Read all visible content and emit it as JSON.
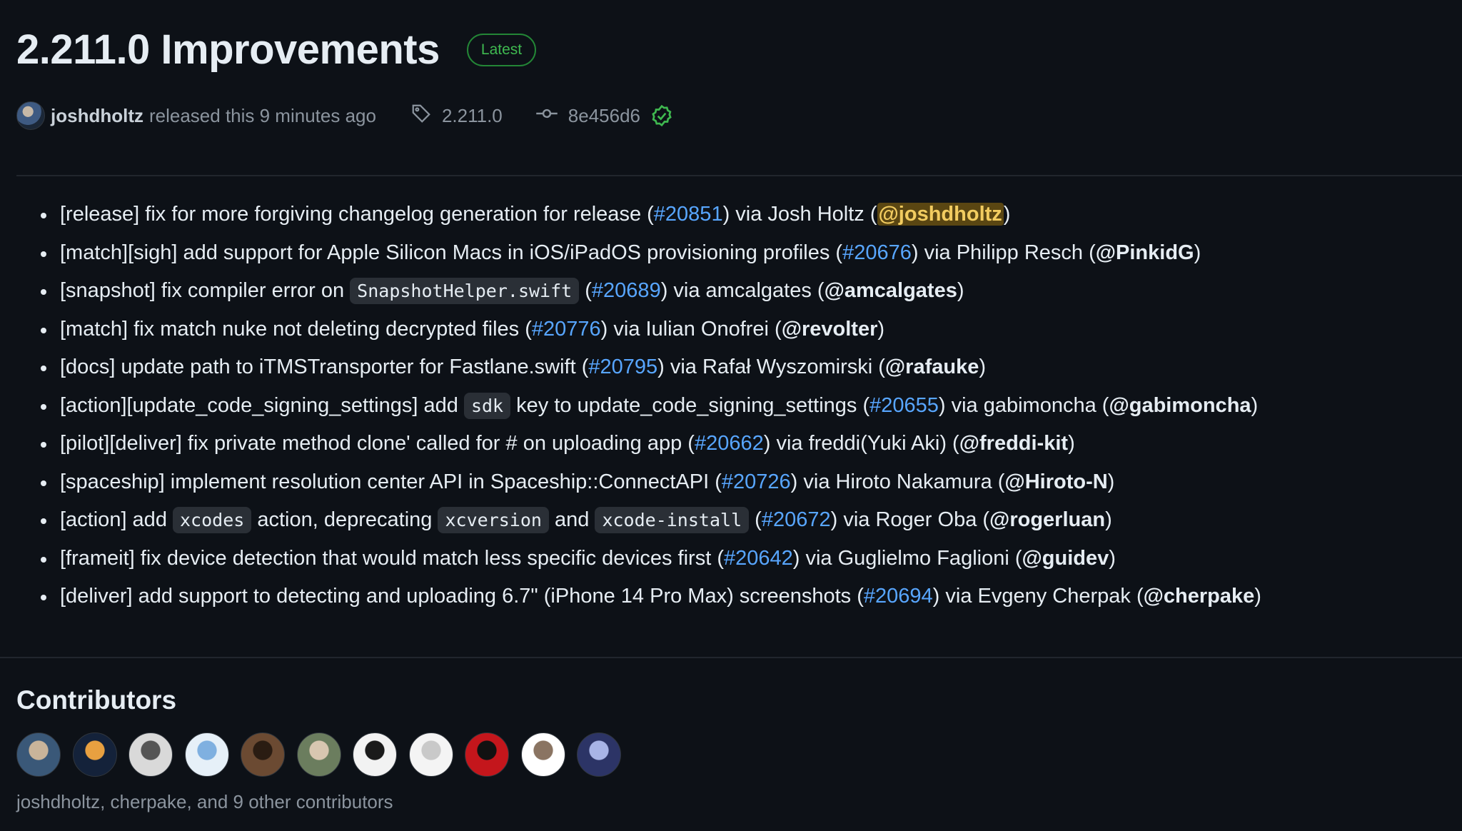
{
  "release": {
    "title": "2.211.0 Improvements",
    "badge": "Latest",
    "author": "joshdholtz",
    "released_text": "released this 9 minutes ago",
    "tag": "2.211.0",
    "commit": "8e456d6"
  },
  "notes": [
    {
      "pre": "[release] fix for more forgiving changelog generation for release (",
      "pr": "#20851",
      "via": ") via Josh Holtz (",
      "handle": "@joshdholtz",
      "end": ")"
    },
    {
      "pre": "[match][sigh] add support for Apple Silicon Macs in iOS/iPadOS provisioning profiles (",
      "pr": "#20676",
      "via": ") via Philipp Resch (",
      "handle": "@PinkidG",
      "end": ")"
    },
    {
      "pre": "[snapshot] fix compiler error on ",
      "code1": "SnapshotHelper.swift",
      "mid": " (",
      "pr": "#20689",
      "via": ") via amcalgates (",
      "handle": "@amcalgates",
      "end": ")"
    },
    {
      "pre": "[match] fix match nuke not deleting decrypted files (",
      "pr": "#20776",
      "via": ") via Iulian Onofrei (",
      "handle": "@revolter",
      "end": ")"
    },
    {
      "pre": "[docs] update path to iTMSTransporter for Fastlane.swift (",
      "pr": "#20795",
      "via": ") via Rafał Wyszomirski (",
      "handle": "@rafauke",
      "end": ")"
    },
    {
      "pre": "[action][update_code_signing_settings] add ",
      "code1": "sdk",
      "mid": " key to update_code_signing_settings (",
      "pr": "#20655",
      "via": ") via gabimoncha (",
      "handle": "@gabimoncha",
      "end": ")"
    },
    {
      "pre": "[pilot][deliver] fix private method clone' called for # on uploading app (",
      "pr": "#20662",
      "via": ") via freddi(Yuki Aki) (",
      "handle": "@freddi-kit",
      "end": ")"
    },
    {
      "pre": "[spaceship] implement resolution center API in Spaceship::ConnectAPI (",
      "pr": "#20726",
      "via": ") via Hiroto Nakamura (",
      "handle": "@Hiroto-N",
      "end": ")"
    },
    {
      "pre": "[action] add ",
      "code1": "xcodes",
      "mid": " action, deprecating ",
      "code2": "xcversion",
      "mid2": " and ",
      "code3": "xcode-install",
      "mid3": " (",
      "pr": "#20672",
      "via": ") via Roger Oba (",
      "handle": "@rogerluan",
      "end": ")"
    },
    {
      "pre": "[frameit] fix device detection that would match less specific devices first (",
      "pr": "#20642",
      "via": ") via Guglielmo Faglioni (",
      "handle": "@guidev",
      "end": ")"
    },
    {
      "pre": "[deliver] add support to detecting and uploading 6.7\" (iPhone 14 Pro Max) screenshots (",
      "pr": "#20694",
      "via": ") via Evgeny Cherpak (",
      "handle": "@cherpake",
      "end": ")"
    }
  ],
  "contributors": {
    "title": "Contributors",
    "summary": "joshdholtz, cherpake, and 9 other contributors",
    "avatars": [
      {
        "name": "avatar-1",
        "bg": "#3a5878",
        "fg": "#c9b49a"
      },
      {
        "name": "avatar-2",
        "bg": "#14223a",
        "fg": "#e8a040"
      },
      {
        "name": "avatar-3",
        "bg": "#d9d9d9",
        "fg": "#555555"
      },
      {
        "name": "avatar-4",
        "bg": "#e6f0f8",
        "fg": "#7fb0e0"
      },
      {
        "name": "avatar-5",
        "bg": "#6b4a32",
        "fg": "#2a1c12"
      },
      {
        "name": "avatar-6",
        "bg": "#6b7d5e",
        "fg": "#d8c6b0"
      },
      {
        "name": "avatar-7",
        "bg": "#f2f2f2",
        "fg": "#1a1a1a"
      },
      {
        "name": "avatar-8",
        "bg": "#f4f4f4",
        "fg": "#c9c9c9"
      },
      {
        "name": "avatar-9",
        "bg": "#c4161c",
        "fg": "#111111"
      },
      {
        "name": "avatar-10",
        "bg": "#ffffff",
        "fg": "#8a7462"
      },
      {
        "name": "avatar-11",
        "bg": "#2c3466",
        "fg": "#a8b4e6"
      }
    ]
  },
  "colors": {
    "link": "#58a6ff",
    "badge": "#3fb950",
    "verified": "#3fb950",
    "mention_highlight": "#5a4612"
  }
}
